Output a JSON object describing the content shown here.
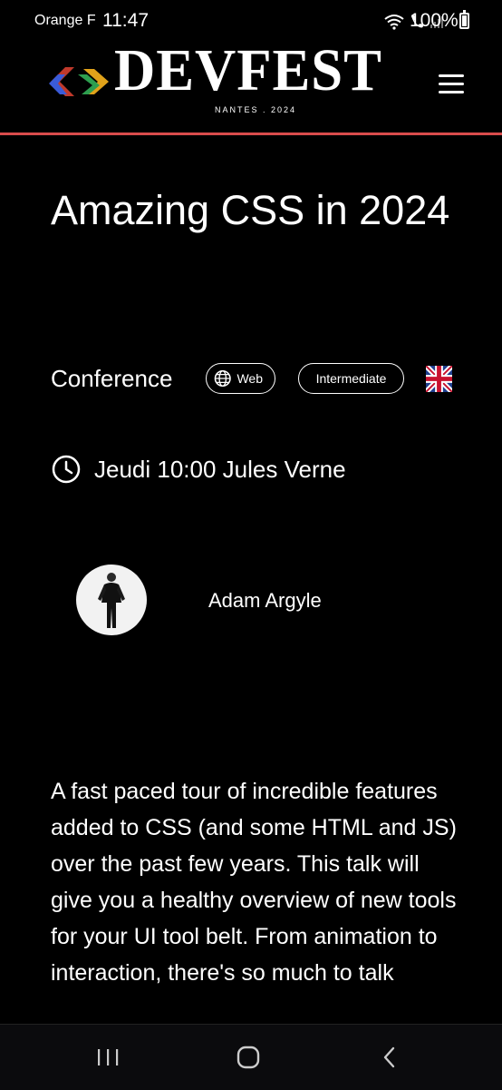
{
  "status_bar": {
    "carrier": "Orange F",
    "time": "11:47",
    "battery": "100%",
    "icons": [
      "wifi-icon",
      "call-icon",
      "signal-icon",
      "battery-icon"
    ]
  },
  "header": {
    "logo_text": "DEVFEST",
    "logo_subtitle": "NANTES . 2024",
    "menu_icon": "hamburger-menu-icon",
    "accent_color": "#d94c4c"
  },
  "talk": {
    "title": "Amazing CSS in 2024",
    "type": "Conference",
    "tags": [
      "Web",
      "Intermediate"
    ],
    "language_icon": "uk-flag-icon",
    "schedule": "Jeudi 10:00 Jules Verne",
    "speaker": {
      "name": "Adam Argyle"
    },
    "abstract": "A fast paced tour of incredible features added to CSS (and some HTML and JS) over the past few years. This talk will give you a healthy overview of new tools for your UI tool belt. From animation to interaction, there's so much to talk"
  },
  "nav_bar": {
    "buttons": [
      "recent-apps-icon",
      "home-icon",
      "back-icon"
    ]
  }
}
